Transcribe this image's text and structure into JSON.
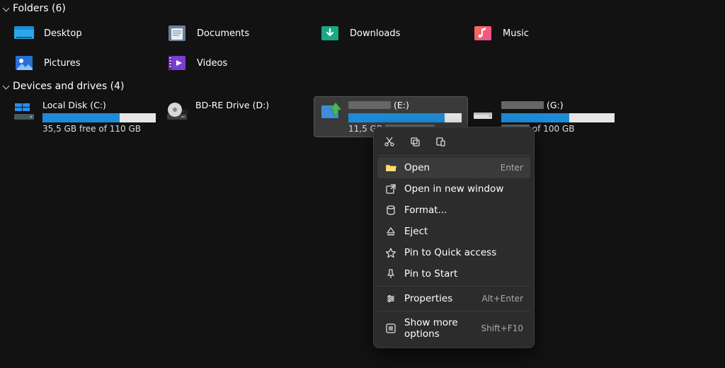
{
  "sections": {
    "folders": {
      "label": "Folders",
      "count": 6
    },
    "drives": {
      "label": "Devices and drives",
      "count": 4
    }
  },
  "folders": [
    {
      "name": "Desktop",
      "icon": "desktop"
    },
    {
      "name": "Documents",
      "icon": "documents"
    },
    {
      "name": "Downloads",
      "icon": "downloads"
    },
    {
      "name": "Music",
      "icon": "music"
    },
    {
      "name": "Pictures",
      "icon": "pictures"
    },
    {
      "name": "Videos",
      "icon": "videos"
    }
  ],
  "drives": [
    {
      "name": "Local Disk (C:)",
      "free_text": "35,5 GB free of 110 GB",
      "fill_pct": 68,
      "icon": "windows-drive",
      "has_bar": true
    },
    {
      "name": "BD-RE Drive (D:)",
      "free_text": "",
      "fill_pct": 0,
      "icon": "optical-drive",
      "has_bar": false
    },
    {
      "name_redacted": true,
      "suffix": "(E:)",
      "free_prefix": "11,5 GB",
      "fill_pct": 85,
      "icon": "removable-drive",
      "has_bar": true,
      "selected": true
    },
    {
      "name_redacted": true,
      "suffix": "(G:)",
      "free_suffix": "of 100 GB",
      "fill_pct": 60,
      "icon": "hdd-drive",
      "has_bar": true
    }
  ],
  "context_menu": {
    "toolbar": [
      "cut",
      "copy",
      "paste"
    ],
    "items": [
      {
        "label": "Open",
        "icon": "open",
        "shortcut": "Enter",
        "hover": true
      },
      {
        "label": "Open in new window",
        "icon": "newwin"
      },
      {
        "label": "Format...",
        "icon": "format"
      },
      {
        "label": "Eject",
        "icon": "eject"
      },
      {
        "label": "Pin to Quick access",
        "icon": "star"
      },
      {
        "label": "Pin to Start",
        "icon": "pin"
      },
      {
        "sep": true
      },
      {
        "label": "Properties",
        "icon": "props",
        "shortcut": "Alt+Enter"
      },
      {
        "sep": true
      },
      {
        "label": "Show more options",
        "icon": "more",
        "shortcut": "Shift+F10"
      }
    ]
  }
}
